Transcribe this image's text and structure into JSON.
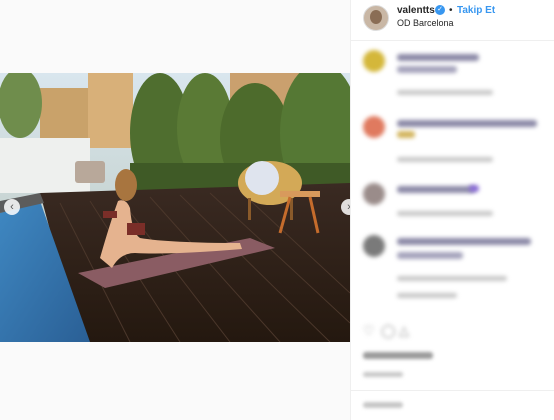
{
  "post": {
    "username": "valentts",
    "verified_glyph": "✓",
    "separator": "•",
    "follow_label": "Takip Et",
    "location": "OD Barcelona"
  },
  "media": {
    "alt": "woman doing yoga stretch on rooftop terrace beside pool",
    "prev_arrow": "‹",
    "next_arrow": "›"
  },
  "icons": {
    "like": "heart-icon",
    "comment": "comment-icon",
    "share": "share-icon"
  },
  "colors": {
    "accent": "#3897f0",
    "text": "#262626",
    "muted": "#8e8e8e",
    "border": "#efefef"
  }
}
